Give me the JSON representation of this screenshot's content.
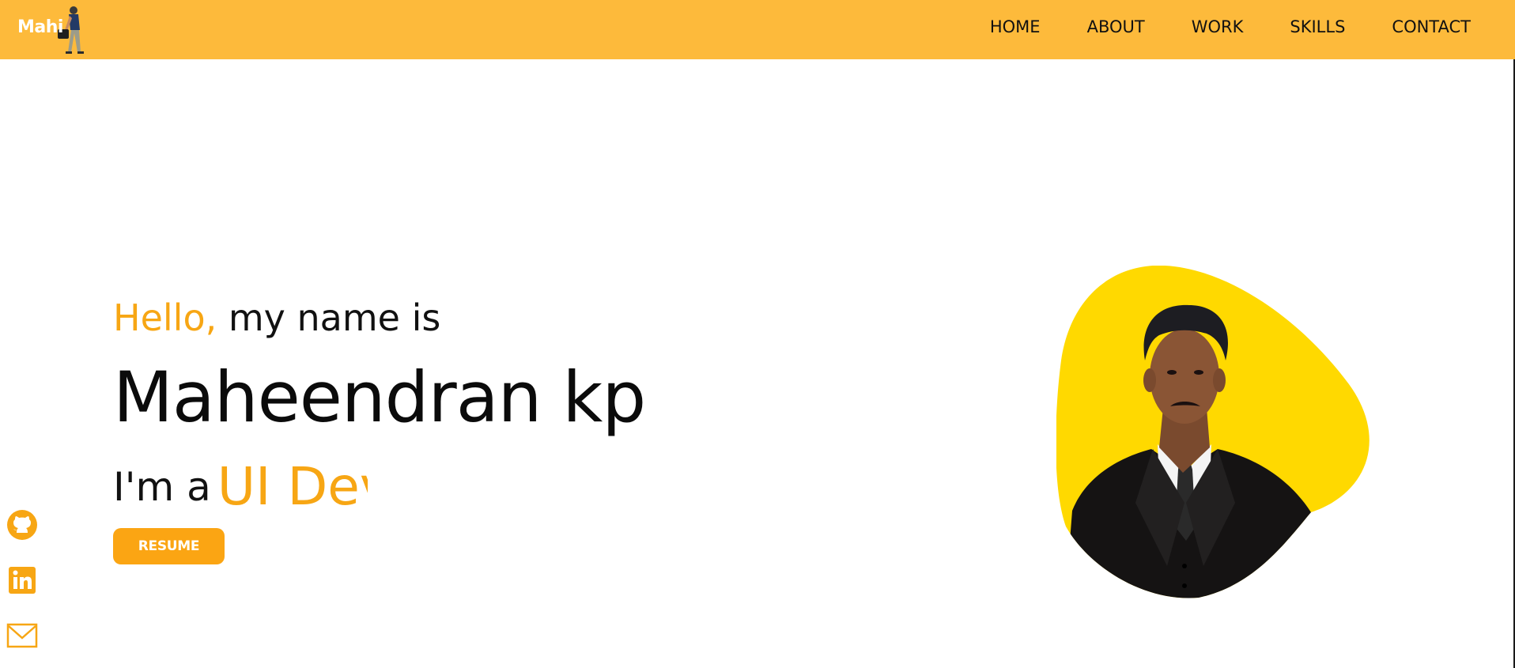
{
  "logo": {
    "text": "Mahi"
  },
  "nav": [
    {
      "label": "HOME"
    },
    {
      "label": "ABOUT"
    },
    {
      "label": "WORK"
    },
    {
      "label": "SKILLS"
    },
    {
      "label": "CONTACT"
    }
  ],
  "hero": {
    "greeting_accent": "Hello,",
    "greeting_rest": " my name is",
    "name": "Maheendran kp",
    "role_prefix": "I'm a",
    "role_typed": "UI Dev",
    "resume_label": "RESUME"
  },
  "socials": [
    {
      "icon": "github-icon"
    },
    {
      "icon": "linkedin-icon"
    },
    {
      "icon": "mail-icon"
    }
  ],
  "colors": {
    "header_bg": "#FDBA3B",
    "accent": "#F7A614",
    "blob": "#FFD900",
    "button": "#FBA513"
  }
}
